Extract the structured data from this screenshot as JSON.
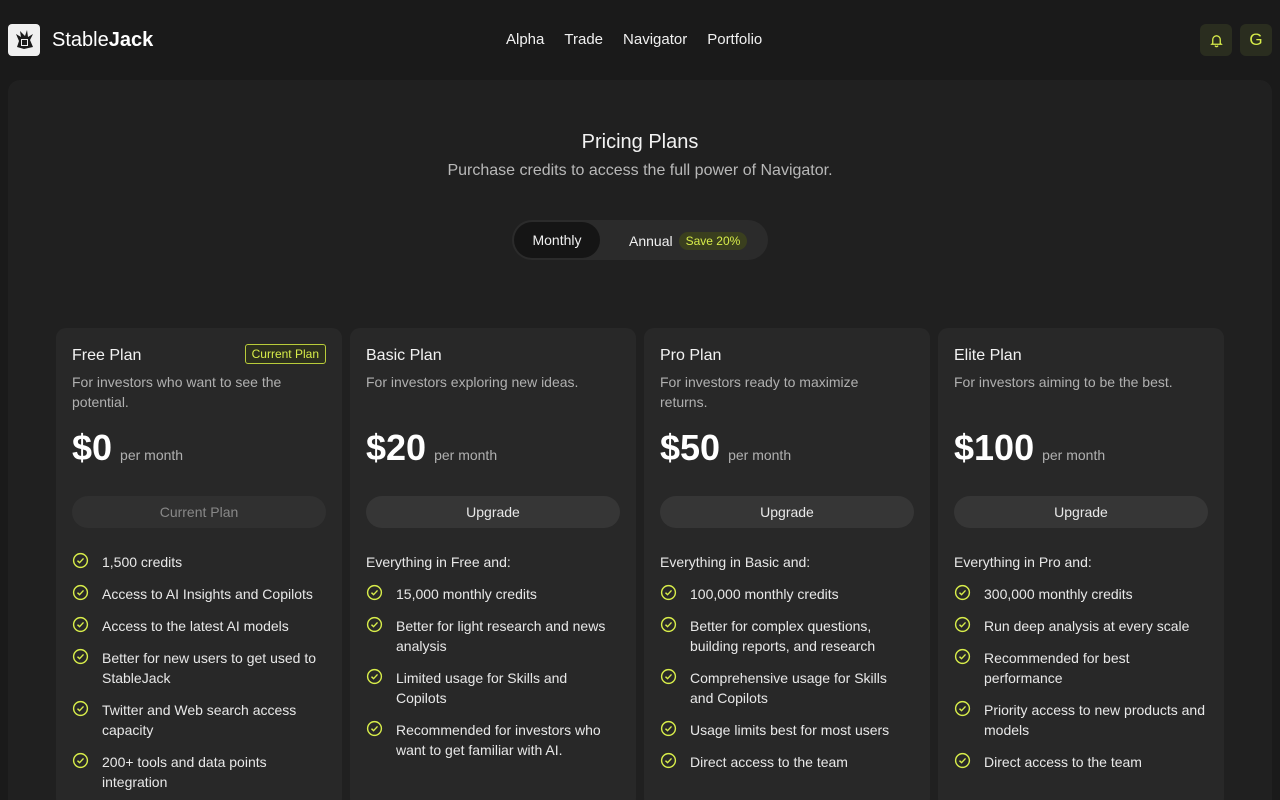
{
  "header": {
    "brand_light": "Stable",
    "brand_bold": "Jack",
    "nav": [
      "Alpha",
      "Trade",
      "Navigator",
      "Portfolio"
    ],
    "bell_icon": "bell-icon",
    "avatar_initial": "G"
  },
  "hero": {
    "title": "Pricing Plans",
    "subtitle": "Purchase credits to access the full power of Navigator."
  },
  "billing_toggle": {
    "monthly_label": "Monthly",
    "annual_label": "Annual",
    "save_badge": "Save 20%",
    "selected": "Monthly"
  },
  "colors": {
    "accent": "#d7ec4a",
    "background": "#1a1a1a",
    "card": "#282828"
  },
  "plans": [
    {
      "name": "Free Plan",
      "badge": "Current Plan",
      "description": "For investors who want to see the potential.",
      "price": "$0",
      "per": "per month",
      "button": "Current Plan",
      "button_disabled": true,
      "features_heading": "",
      "features": [
        "1,500 credits",
        "Access to AI Insights and Copilots",
        "Access to the latest AI models",
        "Better for new users to get used to StableJack",
        "Twitter and Web search access capacity",
        "200+ tools and data points integration"
      ]
    },
    {
      "name": "Basic Plan",
      "badge": "",
      "description": "For investors exploring new ideas.",
      "price": "$20",
      "per": "per month",
      "button": "Upgrade",
      "button_disabled": false,
      "features_heading": "Everything in Free and:",
      "features": [
        "15,000 monthly credits",
        "Better for light research and news analysis",
        "Limited usage for Skills and Copilots",
        "Recommended for investors who want to get familiar with AI."
      ]
    },
    {
      "name": "Pro Plan",
      "badge": "",
      "description": "For investors ready to maximize returns.",
      "price": "$50",
      "per": "per month",
      "button": "Upgrade",
      "button_disabled": false,
      "features_heading": "Everything in Basic and:",
      "features": [
        "100,000 monthly credits",
        "Better for complex questions, building reports, and research",
        "Comprehensive usage for Skills and Copilots",
        "Usage limits best for most users",
        "Direct access to the team"
      ]
    },
    {
      "name": "Elite Plan",
      "badge": "",
      "description": "For investors aiming to be the best.",
      "price": "$100",
      "per": "per month",
      "button": "Upgrade",
      "button_disabled": false,
      "features_heading": "Everything in Pro and:",
      "features": [
        "300,000 monthly credits",
        "Run deep analysis at every scale",
        "Recommended for best performance",
        "Priority access to new products and models",
        "Direct access to the team"
      ]
    }
  ]
}
